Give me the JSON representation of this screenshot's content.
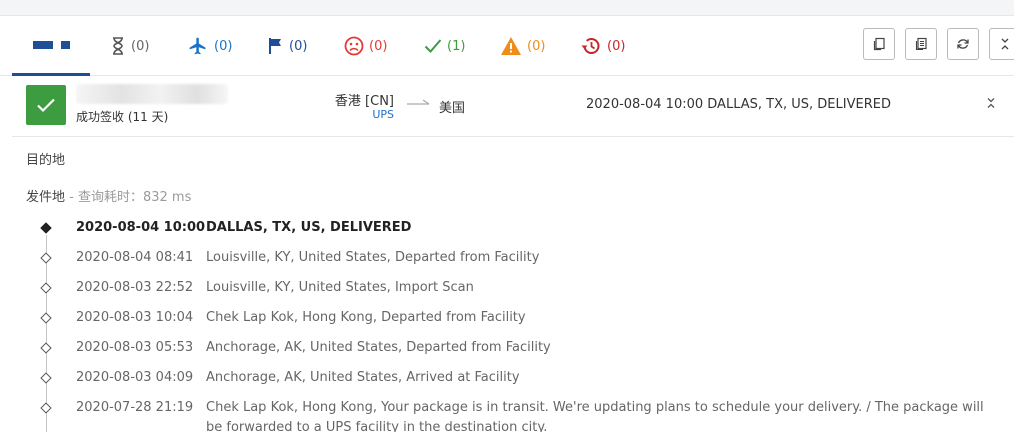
{
  "tabs": [
    {
      "name": "all",
      "count": ""
    },
    {
      "name": "pending",
      "icon": "hourglass-icon",
      "count": "(0)",
      "color": "#666666"
    },
    {
      "name": "in-transit",
      "icon": "airplane-icon",
      "count": "(0)",
      "color": "#1a73c8"
    },
    {
      "name": "pickup",
      "icon": "flag-icon",
      "count": "(0)",
      "color": "#1f4e96"
    },
    {
      "name": "undelivered",
      "icon": "sad-face-icon",
      "count": "(0)",
      "color": "#e53935"
    },
    {
      "name": "delivered",
      "icon": "check-icon",
      "count": "(1)",
      "color": "#3d9b40"
    },
    {
      "name": "alert",
      "icon": "warning-icon",
      "count": "(0)",
      "color": "#f08c1c"
    },
    {
      "name": "expired",
      "icon": "history-icon",
      "count": "(0)",
      "color": "#c62828"
    }
  ],
  "summary": {
    "status_text": "成功签收 (11 天)",
    "origin": "香港 [CN]",
    "carrier": "UPS",
    "destination": "美国",
    "latest_event": "2020-08-04 10:00  DALLAS, TX, US, DELIVERED",
    "status_color": "#3d9b40"
  },
  "labels": {
    "destination": "目的地",
    "origin": "发件地",
    "query_time": " - 查询耗时：832 ms"
  },
  "events": [
    {
      "datetime": "2020-08-04 10:00",
      "description": "DALLAS, TX, US, DELIVERED"
    },
    {
      "datetime": "2020-08-04 08:41",
      "description": "Louisville, KY, United States, Departed from Facility"
    },
    {
      "datetime": "2020-08-03 22:52",
      "description": "Louisville, KY, United States, Import Scan"
    },
    {
      "datetime": "2020-08-03 10:04",
      "description": "Chek Lap Kok, Hong Kong, Departed from Facility"
    },
    {
      "datetime": "2020-08-03 05:53",
      "description": "Anchorage, AK, United States, Departed from Facility"
    },
    {
      "datetime": "2020-08-03 04:09",
      "description": "Anchorage, AK, United States, Arrived at Facility"
    },
    {
      "datetime": "2020-07-28 21:19",
      "description": "Chek Lap Kok, Hong Kong, Your package is in transit. We're updating plans to schedule your delivery. / The package will be forwarded to a UPS facility in the destination city."
    }
  ]
}
